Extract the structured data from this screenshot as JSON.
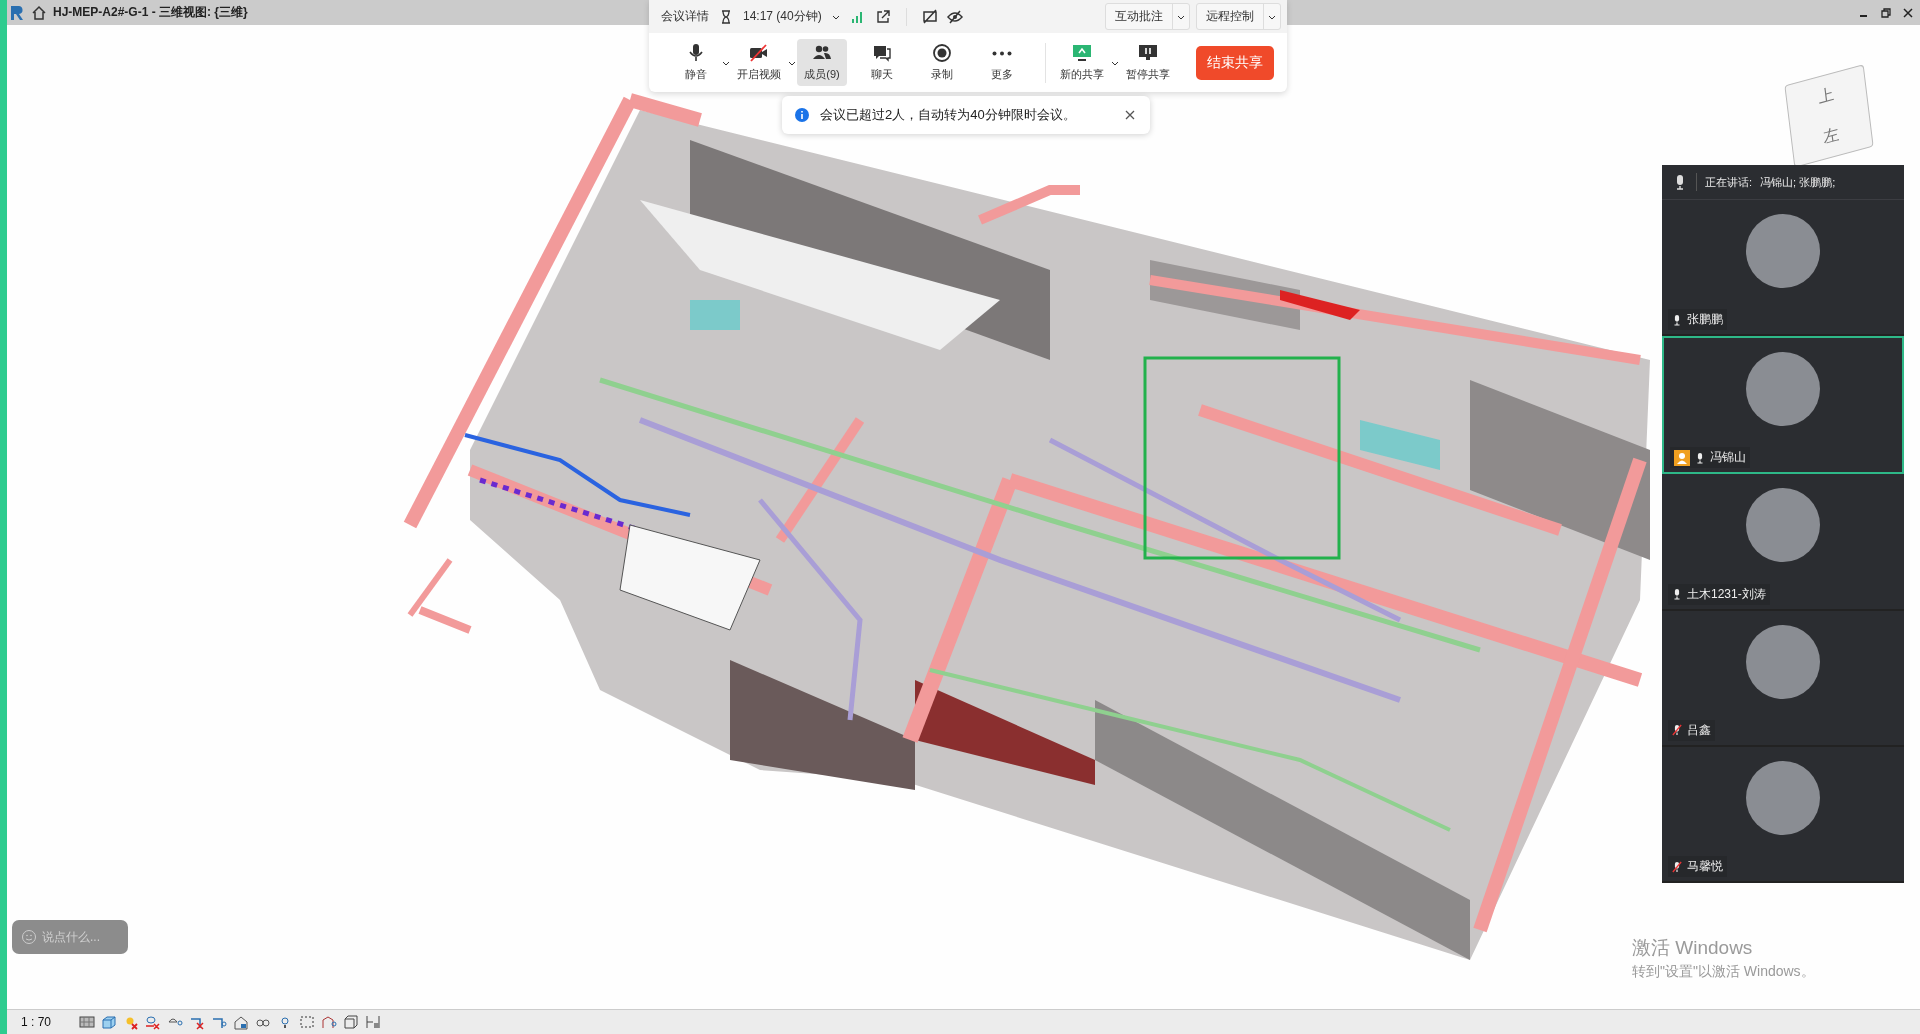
{
  "window": {
    "title": "HJ-MEP-A2#-G-1 - 三维视图: {三维}"
  },
  "meeting_bar": {
    "details": "会议详情",
    "timer": "14:17 (40分钟)",
    "buttons": [
      {
        "label": "互动批注"
      },
      {
        "label": "远程控制"
      }
    ],
    "tools": [
      {
        "label": "静音",
        "kind": "mic",
        "dropdown": true,
        "selected": false
      },
      {
        "label": "开启视频",
        "kind": "camera",
        "dropdown": true,
        "selected": false
      },
      {
        "label": "成员(9)",
        "kind": "people",
        "dropdown": false,
        "selected": true
      },
      {
        "label": "聊天",
        "kind": "chat",
        "dropdown": false,
        "selected": false
      },
      {
        "label": "录制",
        "kind": "record",
        "dropdown": false,
        "selected": false
      },
      {
        "label": "更多",
        "kind": "more",
        "dropdown": false,
        "selected": false
      },
      {
        "label": "新的共享",
        "kind": "share",
        "dropdown": true,
        "selected": false
      },
      {
        "label": "暂停共享",
        "kind": "pause",
        "dropdown": false,
        "selected": false
      }
    ],
    "end_button": "结束共享"
  },
  "notice": {
    "text": "会议已超过2人，自动转为40分钟限时会议。"
  },
  "view_cube": {
    "top": "上",
    "left": "左"
  },
  "participants_panel": {
    "speaking_label": "正在讲话:",
    "speakers": "冯锦山; 张鹏鹏;",
    "participants": [
      {
        "name": "张鹏鹏",
        "muted": false,
        "selected": false,
        "host": false
      },
      {
        "name": "冯锦山",
        "muted": false,
        "selected": true,
        "host": true
      },
      {
        "name": "土木1231-刘涛",
        "muted": false,
        "selected": false,
        "host": false
      },
      {
        "name": "吕鑫",
        "muted": true,
        "selected": false,
        "host": false
      },
      {
        "name": "马馨悦",
        "muted": true,
        "selected": false,
        "host": false
      }
    ]
  },
  "chat_field": {
    "placeholder": "说点什么..."
  },
  "activation_notice": {
    "title": "激活 Windows",
    "text": "转到\"设置\"以激活 Windows。"
  },
  "status_bar": {
    "scale": "1 : 70"
  }
}
